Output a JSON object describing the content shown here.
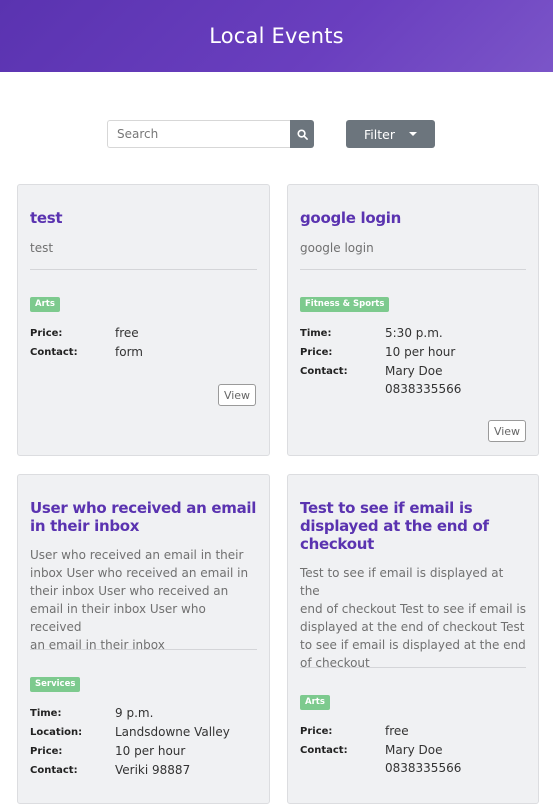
{
  "header": {
    "title": "Local Events"
  },
  "search": {
    "placeholder": "Search",
    "value": ""
  },
  "filter": {
    "label": "Filter"
  },
  "labels": {
    "time": "Time:",
    "location": "Location:",
    "price": "Price:",
    "contact": "Contact:",
    "view": "View"
  },
  "events": [
    {
      "title": "test",
      "description": "test",
      "category": "Arts",
      "price": "free",
      "contact": "form"
    },
    {
      "title": "google login",
      "description": "google login",
      "category": "Fitness & Sports",
      "time": "5:30 p.m.",
      "price": "10 per hour",
      "contact_name": "Mary Doe",
      "contact_phone": "0838335566"
    },
    {
      "title_line1": "User who received an email",
      "title_line2": "in their inbox",
      "desc_lines": [
        "User who received an email in their",
        "inbox User who received an email in",
        "their inbox User who received an",
        "email in their inbox User who received",
        "an email in their inbox"
      ],
      "category": "Services",
      "time": "9 p.m.",
      "location": "Landsdowne Valley",
      "price": "10 per hour",
      "contact": "Veriki 98887"
    },
    {
      "title_lines": [
        "Test to see if email is",
        "displayed at the end of",
        "checkout"
      ],
      "desc_lines": [
        "Test to see if email is displayed at the",
        "end of checkout Test to see if email is",
        "displayed at the end of checkout Test",
        "to see if email is displayed at the end",
        "of checkout"
      ],
      "category": "Arts",
      "price": "free",
      "contact_name": "Mary Doe",
      "contact_phone": "0838335566"
    }
  ],
  "colors": {
    "brand": "#5a33b0",
    "badge": "#7dca8e",
    "button": "#6c757d",
    "card_bg": "#f0f1f3"
  }
}
